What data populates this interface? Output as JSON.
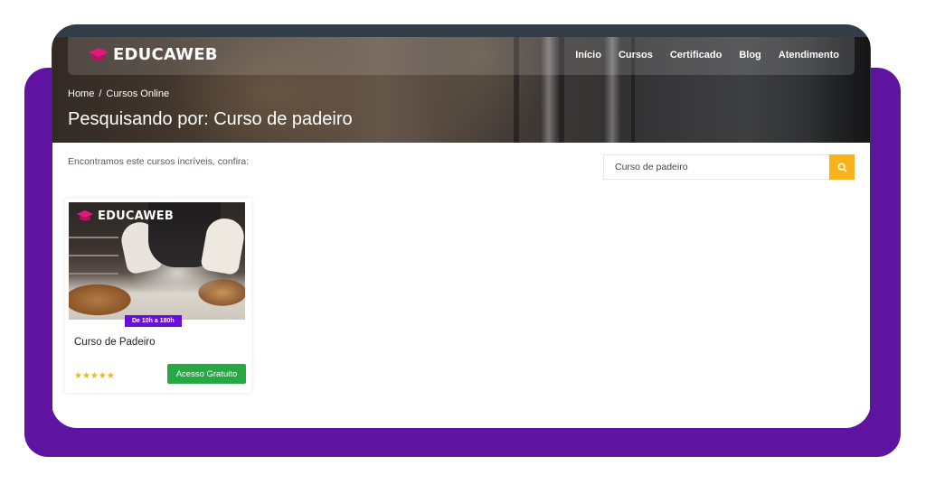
{
  "brand": {
    "name": "EDUCAWEB",
    "accent": "#e0197d"
  },
  "nav": {
    "items": [
      {
        "label": "Início"
      },
      {
        "label": "Cursos"
      },
      {
        "label": "Certificado"
      },
      {
        "label": "Blog"
      },
      {
        "label": "Atendimento"
      }
    ]
  },
  "breadcrumb": {
    "home": "Home",
    "separator": "/",
    "current": "Cursos Online"
  },
  "page": {
    "title": "Pesquisando por: Curso de padeiro",
    "intro": "Encontramos este cursos incríveis, confira:"
  },
  "search": {
    "value": "Curso de padeiro",
    "button_color": "#f6b31a",
    "icon": "search-icon"
  },
  "results": [
    {
      "title": "Curso de Padeiro",
      "badge": "De 10h a 180h",
      "rating": 5,
      "rating_stars": "★★★★★",
      "cta": "Acesso Gratuito",
      "image_logo": "EDUCAWEB"
    }
  ],
  "colors": {
    "frame": "#5e14a0",
    "device": "#333d47",
    "badge": "#6a0ddd",
    "cta": "#28a745",
    "stars": "#f4b41a"
  }
}
